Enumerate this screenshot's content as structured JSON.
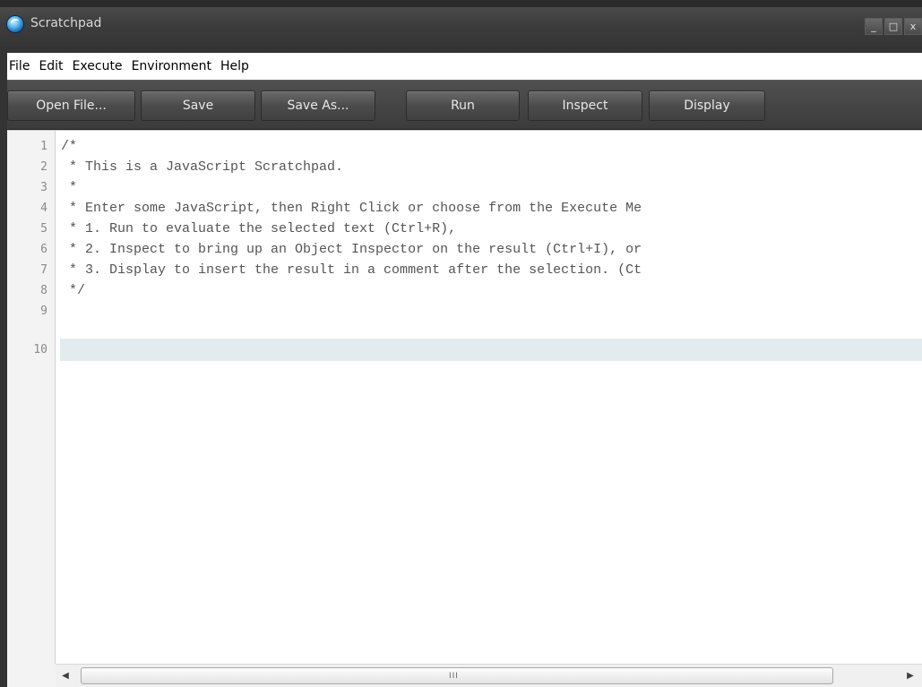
{
  "window": {
    "title": "Scratchpad",
    "controls": [
      "_",
      "□",
      "x"
    ]
  },
  "menu": [
    {
      "label": "File"
    },
    {
      "label": "Edit"
    },
    {
      "label": "Execute"
    },
    {
      "label": "Environment"
    },
    {
      "label": "Help"
    }
  ],
  "toolbar": {
    "open_label": "Open File...",
    "save_label": "Save",
    "save_as_label": "Save As...",
    "run_label": "Run",
    "inspect_label": "Inspect",
    "display_label": "Display"
  },
  "editor": {
    "line_numbers": [
      "1",
      "2",
      "3",
      "4",
      "5",
      "6",
      "7",
      "8",
      "9",
      "10"
    ],
    "lines": [
      "/*",
      " * This is a JavaScript Scratchpad.",
      " *",
      " * Enter some JavaScript, then Right Click or choose from the Execute Me",
      " * 1. Run to evaluate the selected text (Ctrl+R),",
      " * 2. Inspect to bring up an Object Inspector on the result (Ctrl+I), or",
      " * 3. Display to insert the result in a comment after the selection. (Ct",
      " */",
      "",
      ""
    ],
    "current_line": 10
  },
  "scrollbar": {
    "grip": "III"
  },
  "colors": {
    "titlebar": "#3c3c3c",
    "toolbar": "#454545",
    "current_line_highlight": "#e4ebee",
    "code_text": "#555555"
  }
}
